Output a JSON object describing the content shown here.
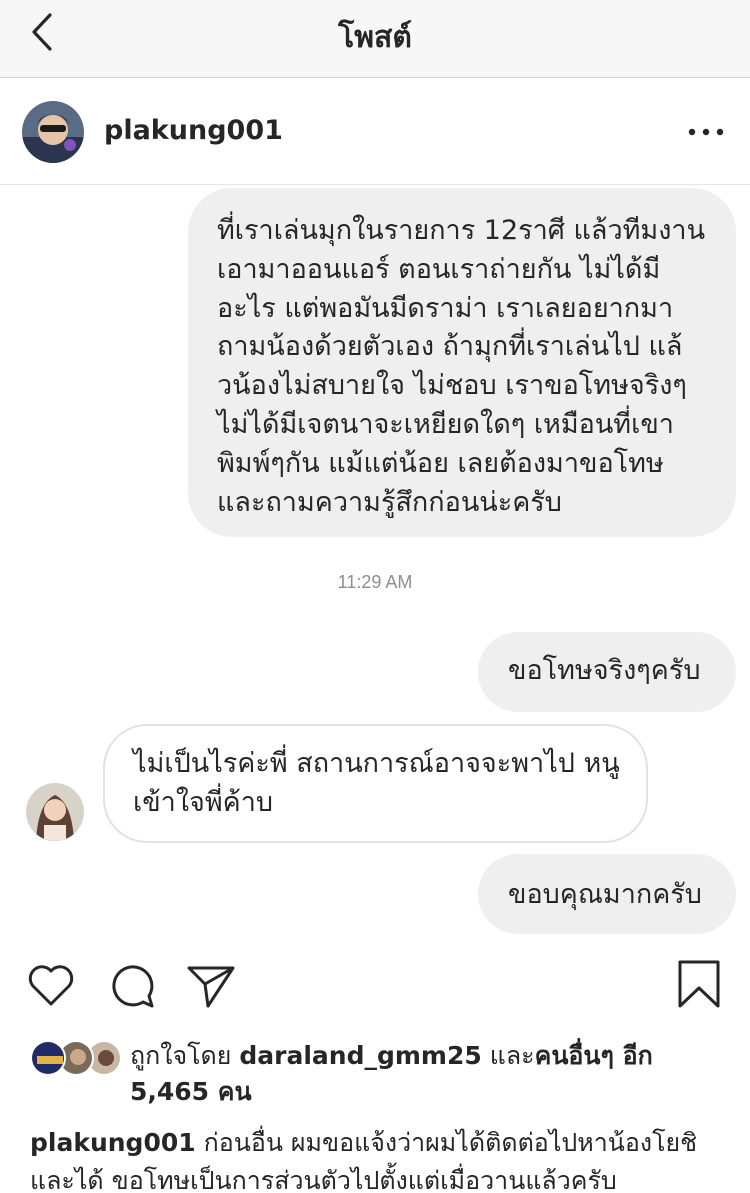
{
  "topbar": {
    "title": "โพสต์"
  },
  "header": {
    "username": "plakung001"
  },
  "chat": {
    "messages": [
      {
        "text": "ที่เราเล่นมุกในรายการ 12ราศี แล้วทีมงาน\nเอามาออนแอร์ ตอนเราถ่ายกัน ไม่ได้มี\nอะไร แต่พอมันมีดราม่า เราเลยอยากมา\nถามน้องด้วยตัวเอง ถ้ามุกที่เราเล่นไป แล้\nวน้องไม่สบายใจ ไม่ชอบ เราขอโทษจริงๆ\nไม่ได้มีเจตนาจะเหยียดใดๆ เหมือนที่เขา\nพิมพ์ๆกัน แม้แต่น้อย เลยต้องมาขอโทษ\nและถามความรู้สึกก่อนน่ะครับ"
      },
      {
        "text": "ขอโทษจริงๆครับ"
      },
      {
        "text": "ไม่เป็นไรค่ะพี่ สถานการณ์อาจจะพาไป หนู\nเข้าใจพี่ค้าบ"
      },
      {
        "text": "ขอบคุณมากครับ"
      }
    ],
    "timestamp": "11:29 AM"
  },
  "likes": {
    "prefix": "ถูกใจโดย ",
    "user": "daraland_gmm25",
    "middle": " และ",
    "others": "คนอื่นๆ อีก 5,465 คน"
  },
  "caption": {
    "username": "plakung001",
    "text": " ก่อนอื่น ผมขอแจ้งว่าผมได้ติดต่อไปหาน้องโยชิ และได้ ขอโทษเป็นการส่วนตัวไปตั้งแต่เมื่อวานแล้วครับ"
  },
  "icons": [
    "back-chevron",
    "more-dots",
    "heart",
    "comment",
    "share-plane",
    "bookmark"
  ],
  "colors": {
    "bubble_out": "#efefef",
    "bubble_in_border": "#e2e2e2",
    "text": "#262626",
    "timestamp": "#8e8e8e"
  }
}
